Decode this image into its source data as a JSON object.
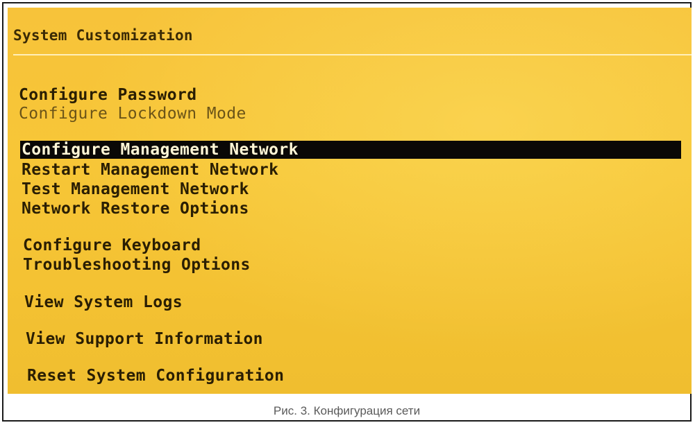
{
  "header": {
    "title": "System Customization"
  },
  "menu": {
    "items": [
      {
        "label": "Configure Password"
      },
      {
        "label": "Configure Lockdown Mode"
      },
      {
        "label": "Configure Management Network"
      },
      {
        "label": "Restart Management Network"
      },
      {
        "label": "Test Management Network"
      },
      {
        "label": "Network Restore Options"
      },
      {
        "label": "Configure Keyboard"
      },
      {
        "label": "Troubleshooting Options"
      },
      {
        "label": "View System Logs"
      },
      {
        "label": "View Support Information"
      },
      {
        "label": "Reset System Configuration"
      }
    ],
    "selected": "Configure Management Network"
  },
  "caption": "Рис. 3. Конфигурация сети"
}
